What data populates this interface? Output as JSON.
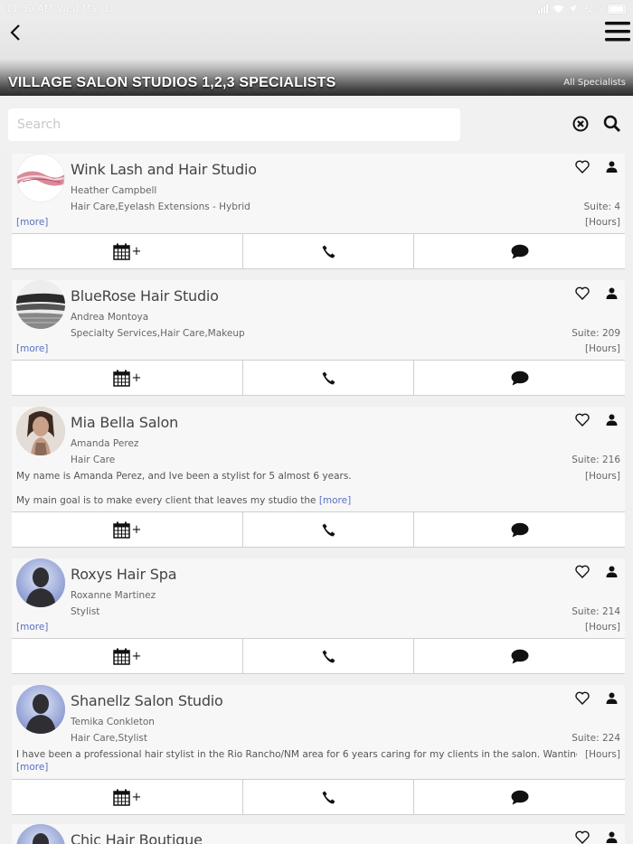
{
  "status_bar": {
    "time": "11:30 AM",
    "date": "Wed Mar 10",
    "battery": "92%"
  },
  "header": {
    "title": "VILLAGE SALON STUDIOS 1,2,3 SPECIALISTS",
    "all_link": "All Specialists"
  },
  "search": {
    "placeholder": "Search"
  },
  "links": {
    "more": "[more]",
    "hours": "[Hours]"
  },
  "specialists": [
    {
      "name": "Wink Lash and Hair Studio",
      "owner": "Heather Campbell",
      "services": "Hair Care,Eyelash Extensions - Hybrid",
      "suite": "Suite: 4",
      "avatar": "lash-avatar"
    },
    {
      "name": "BlueRose Hair Studio",
      "owner": "Andrea Montoya",
      "services": "Specialty Services,Hair Care,Makeup",
      "suite": "Suite: 209",
      "avatar": "landscape-avatar"
    },
    {
      "name": "Mia Bella Salon",
      "owner": "Amanda Perez",
      "services": "Hair Care",
      "suite": "Suite: 216",
      "avatar": "portrait-avatar",
      "desc1": "My name is Amanda Perez, and Ive been a stylist for 5 almost 6 years.",
      "desc2": "My main goal is to make every client that leaves my studio the "
    },
    {
      "name": "Roxys Hair Spa",
      "owner": "Roxanne Martinez",
      "services": "Stylist",
      "suite": "Suite: 214",
      "avatar": "default-avatar"
    },
    {
      "name": "Shanellz Salon Studio",
      "owner": "Temika Conkleton",
      "services": "Hair Care,Stylist",
      "suite": "Suite: 224",
      "avatar": "default-avatar",
      "desc1": "I have been a professional hair stylist in the Rio Rancho/NM area for 6 years caring for my clients in the salon. Wanting to focus solely on"
    },
    {
      "name": "Chic Hair Boutique",
      "avatar": "default-avatar"
    }
  ]
}
